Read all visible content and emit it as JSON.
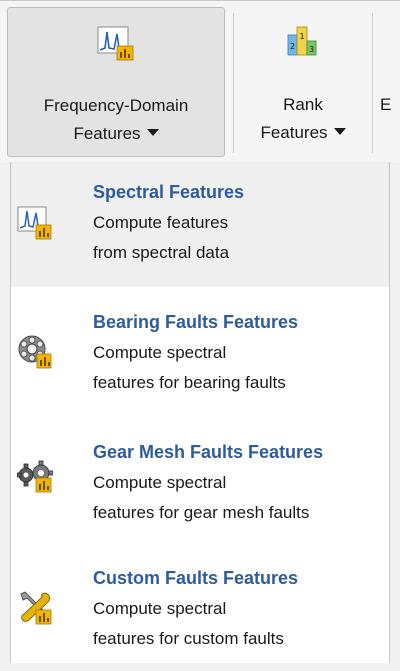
{
  "toolstrip": {
    "frequency_domain": {
      "line1": "Frequency-Domain",
      "line2": "Features"
    },
    "rank": {
      "line1": "Rank",
      "line2": "Features"
    },
    "partial_next": "E"
  },
  "menu": {
    "items": [
      {
        "title": "Spectral Features",
        "desc1": "Compute features",
        "desc2": "from spectral data",
        "icon": "spectrum-icon"
      },
      {
        "title": "Bearing Faults Features",
        "desc1": "Compute spectral",
        "desc2": "features for bearing faults",
        "icon": "bearing-icon"
      },
      {
        "title": "Gear Mesh Faults Features",
        "desc1": "Compute spectral",
        "desc2": "features for gear mesh faults",
        "icon": "gear-icon"
      },
      {
        "title": "Custom Faults Features",
        "desc1": "Compute spectral",
        "desc2": "features for custom faults",
        "icon": "tools-icon"
      }
    ]
  },
  "colors": {
    "accent": "#2e5c9a",
    "highlight": "#efefef",
    "badge": "#f2b600"
  }
}
